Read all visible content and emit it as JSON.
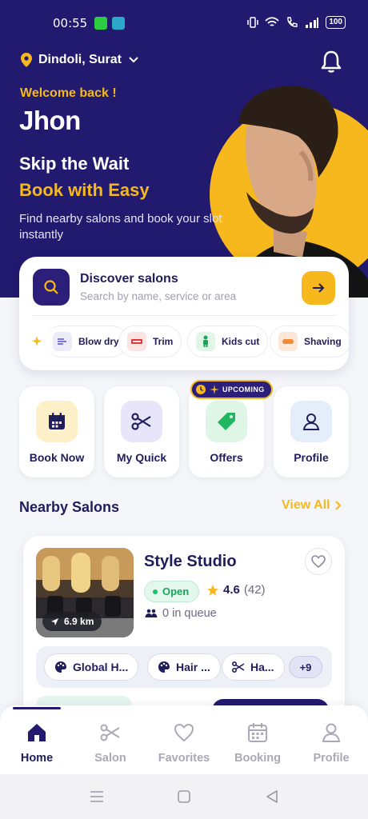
{
  "status_bar": {
    "time": "00:55",
    "battery": "100"
  },
  "location": {
    "name": "Dindoli, Surat"
  },
  "hero": {
    "welcome": "Welcome back !",
    "username": "Jhon",
    "headline": "Skip the Wait",
    "headline_accent": "Book with Easy",
    "description": "Find nearby salons and book your slot instantly"
  },
  "search": {
    "title": "Discover salons",
    "placeholder": "Search by name, service or area"
  },
  "service_chips": [
    {
      "label": "Blow dry",
      "icon": "wind-icon"
    },
    {
      "label": "Trim",
      "icon": "razor-icon"
    },
    {
      "label": "Kids cut",
      "icon": "child-icon"
    },
    {
      "label": "Shaving",
      "icon": "shaving-icon"
    }
  ],
  "quick_actions": [
    {
      "label": "Book Now",
      "icon": "calendar-icon"
    },
    {
      "label": "My Quick",
      "icon": "scissors-icon"
    },
    {
      "label": "Offers",
      "icon": "tag-icon"
    },
    {
      "label": "Profile",
      "icon": "user-icon"
    }
  ],
  "offers_badge": "UPCOMING",
  "nearby": {
    "title": "Nearby Salons",
    "view_all": "View All"
  },
  "salon": {
    "name": "Style Studio",
    "status": "Open",
    "rating": "4.6",
    "reviews": "(42)",
    "queue": "0 in queue",
    "distance": "6.9 km",
    "services": [
      "Global H...",
      "Hair ...",
      "Ha..."
    ],
    "more": "+9"
  },
  "bottom_nav": [
    {
      "label": "Home",
      "icon": "home-icon",
      "active": true
    },
    {
      "label": "Salon",
      "icon": "scissors-icon",
      "active": false
    },
    {
      "label": "Favorites",
      "icon": "heart-icon",
      "active": false
    },
    {
      "label": "Booking",
      "icon": "calendar-icon",
      "active": false
    },
    {
      "label": "Profile",
      "icon": "user-icon",
      "active": false
    }
  ],
  "colors": {
    "primary": "#221a6e",
    "accent": "#f6b81c",
    "success": "#1aa55a"
  }
}
